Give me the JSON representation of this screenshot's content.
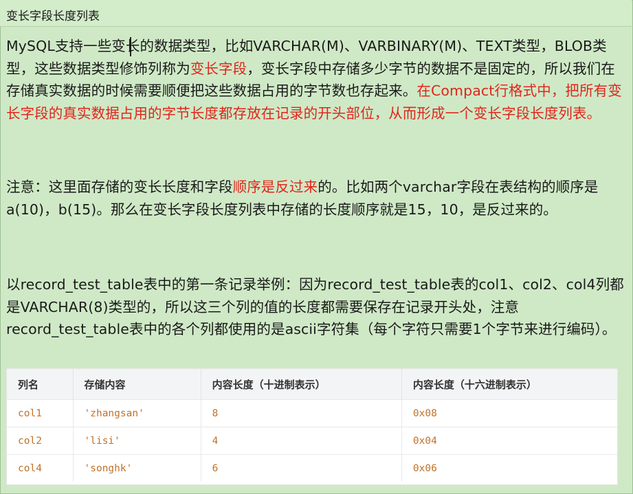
{
  "title": "变长字段长度列表",
  "p1": {
    "a": "MySQL支持一些变长的数据类型，比如VARCHAR(M)、VARBINARY(M)、TEXT类型，BLOB类型，这些数据类型修饰列称为",
    "b": "变长字段",
    "c": "，变长字段中存储多少字节的数据不是固定的，所以我们在存储真实数据的时候需要顺便把这些数据占用的字节数也存起来。",
    "d": "在Compact行格式中，把所有变长字段的真实数据占用的字节长度都存放在记录的开头部位，从而形成一个变长字段长度列表。"
  },
  "p2": {
    "a": "注意：这里面存储的变长长度和字段",
    "b": "顺序是反过来",
    "c": "的。比如两个varchar字段在表结构的顺序是a(10)，b(15)。那么在变长字段长度列表中存储的长度顺序就是15，10，是反过来的。"
  },
  "p3": "以record_test_table表中的第一条记录举例：因为record_test_table表的col1、col2、col4列都是VARCHAR(8)类型的，所以这三个列的值的长度都需要保存在记录开头处，注意record_test_table表中的各个列都使用的是ascii字符集（每个字符只需要1个字节来进行编码）。",
  "table": {
    "headers": [
      "列名",
      "存储内容",
      "内容长度（十进制表示）",
      "内容长度（十六进制表示）"
    ],
    "rows": [
      [
        "col1",
        "'zhangsan'",
        "8",
        "0x08"
      ],
      [
        "col2",
        "'lisi'",
        "4",
        "0x04"
      ],
      [
        "col4",
        "'songhk'",
        "6",
        "0x06"
      ]
    ]
  }
}
